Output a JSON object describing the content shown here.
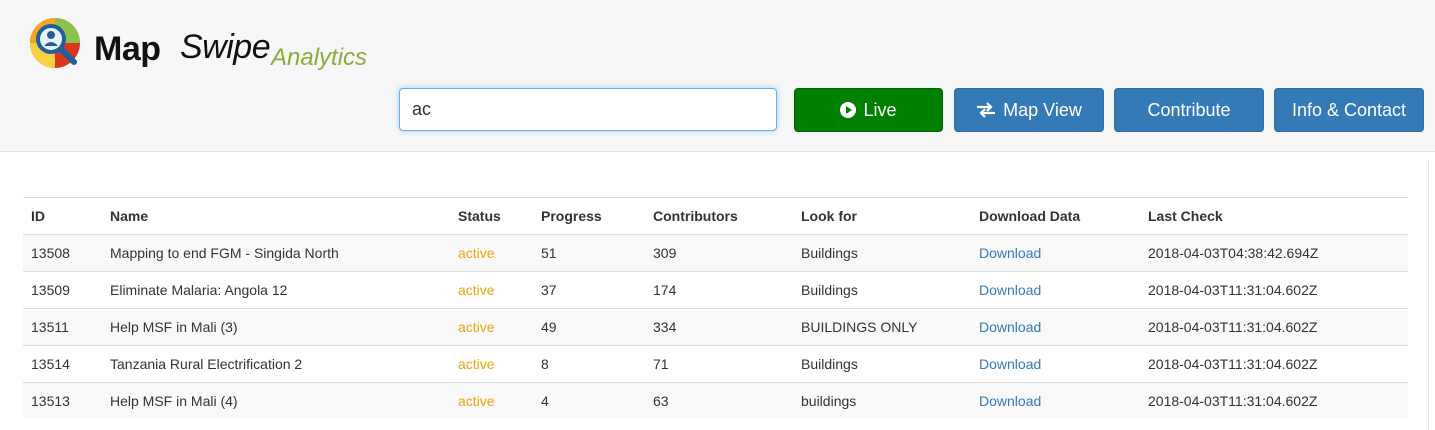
{
  "brand": {
    "name_bold": "Map",
    "name_italic": "Swipe",
    "subtitle": "Analytics"
  },
  "search": {
    "value": "ac"
  },
  "nav": {
    "live_label": "Live",
    "map_view_label": "Map View",
    "contribute_label": "Contribute",
    "info_label": "Info & Contact"
  },
  "colors": {
    "live_green": "#008000",
    "primary_blue": "#337ab7",
    "status_orange": "#f0a30a",
    "brand_green": "#8bab3b"
  },
  "table": {
    "headers": {
      "id": "ID",
      "name": "Name",
      "status": "Status",
      "progress": "Progress",
      "contributors": "Contributors",
      "look_for": "Look for",
      "download": "Download Data",
      "last_check": "Last Check"
    },
    "rows": [
      {
        "id": "13508",
        "name": "Mapping to end FGM - Singida North",
        "status": "active",
        "progress": "51",
        "contributors": "309",
        "look_for": "Buildings",
        "download": "Download",
        "last_check": "2018-04-03T04:38:42.694Z"
      },
      {
        "id": "13509",
        "name": "Eliminate Malaria: Angola 12",
        "status": "active",
        "progress": "37",
        "contributors": "174",
        "look_for": "Buildings",
        "download": "Download",
        "last_check": "2018-04-03T11:31:04.602Z"
      },
      {
        "id": "13511",
        "name": "Help MSF in Mali (3)",
        "status": "active",
        "progress": "49",
        "contributors": "334",
        "look_for": "BUILDINGS ONLY",
        "download": "Download",
        "last_check": "2018-04-03T11:31:04.602Z"
      },
      {
        "id": "13514",
        "name": "Tanzania Rural Electrification 2",
        "status": "active",
        "progress": "8",
        "contributors": "71",
        "look_for": "Buildings",
        "download": "Download",
        "last_check": "2018-04-03T11:31:04.602Z"
      },
      {
        "id": "13513",
        "name": "Help MSF in Mali (4)",
        "status": "active",
        "progress": "4",
        "contributors": "63",
        "look_for": "buildings",
        "download": "Download",
        "last_check": "2018-04-03T11:31:04.602Z"
      }
    ]
  }
}
